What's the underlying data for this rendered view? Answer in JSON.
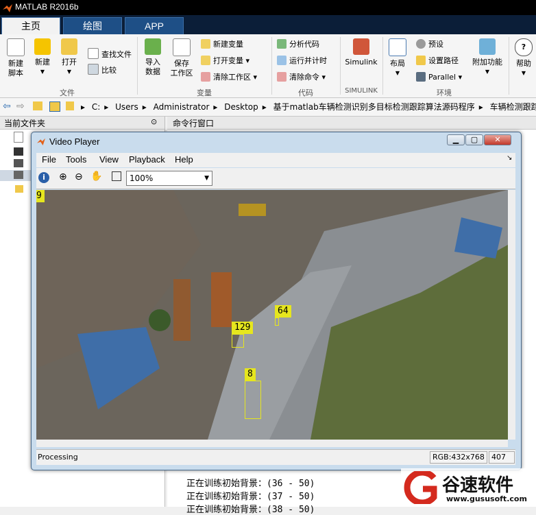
{
  "app": {
    "title": "MATLAB R2016b"
  },
  "tabs": [
    {
      "label": "主页",
      "active": true
    },
    {
      "label": "绘图"
    },
    {
      "label": "APP"
    }
  ],
  "ribbon": {
    "file": {
      "new_script": "新建\n脚本",
      "new": "新建",
      "open": "打开",
      "find_files": "查找文件",
      "compare": "比较",
      "section": "文件"
    },
    "variable": {
      "import_data": "导入\n数据",
      "save_workspace": "保存\n工作区",
      "new_variable": "新建变量",
      "open_variable": "打开变量",
      "clear_workspace": "清除工作区",
      "section": "变量"
    },
    "code": {
      "analyze_code": "分析代码",
      "run_and_time": "运行并计时",
      "clear_commands": "清除命令",
      "section": "代码"
    },
    "simulink": {
      "label": "Simulink",
      "section": "SIMULINK"
    },
    "environment": {
      "layout": "布局",
      "preferences": "预设",
      "set_path": "设置路径",
      "parallel": "Parallel",
      "addons": "附加功能",
      "section": "环境"
    },
    "resources": {
      "help": "帮助"
    }
  },
  "address_bar": {
    "segments": [
      "C:",
      "Users",
      "Administrator",
      "Desktop",
      "基于matlab车辆检测识别多目标检测跟踪算法源码程序",
      "车辆检测跟踪"
    ]
  },
  "panes": {
    "current_folder": "当前文件夹",
    "command_window": "命令行窗口"
  },
  "command_output": [
    "正在训练初始背景：(36 - 50)",
    "正在训练初始背景：(37 - 50)",
    "正在训练初始背景：(38 - 50)"
  ],
  "video_player": {
    "title": "Video Player",
    "menu": [
      "File",
      "Tools",
      "View",
      "Playback",
      "Help"
    ],
    "zoom": "100%",
    "status": "Processing",
    "rgb_info": "RGB:432x768",
    "frame": "407",
    "track_labels": [
      "9",
      "64",
      "129",
      "8"
    ]
  },
  "watermark": {
    "brand": "谷速软件",
    "url": "www.gususoft.com"
  },
  "colors": {
    "track_label": "#e6e61e",
    "tab_active_bg": "#f2f2f2",
    "tab_bg": "#1e4f86",
    "titlebar": "#000000"
  }
}
